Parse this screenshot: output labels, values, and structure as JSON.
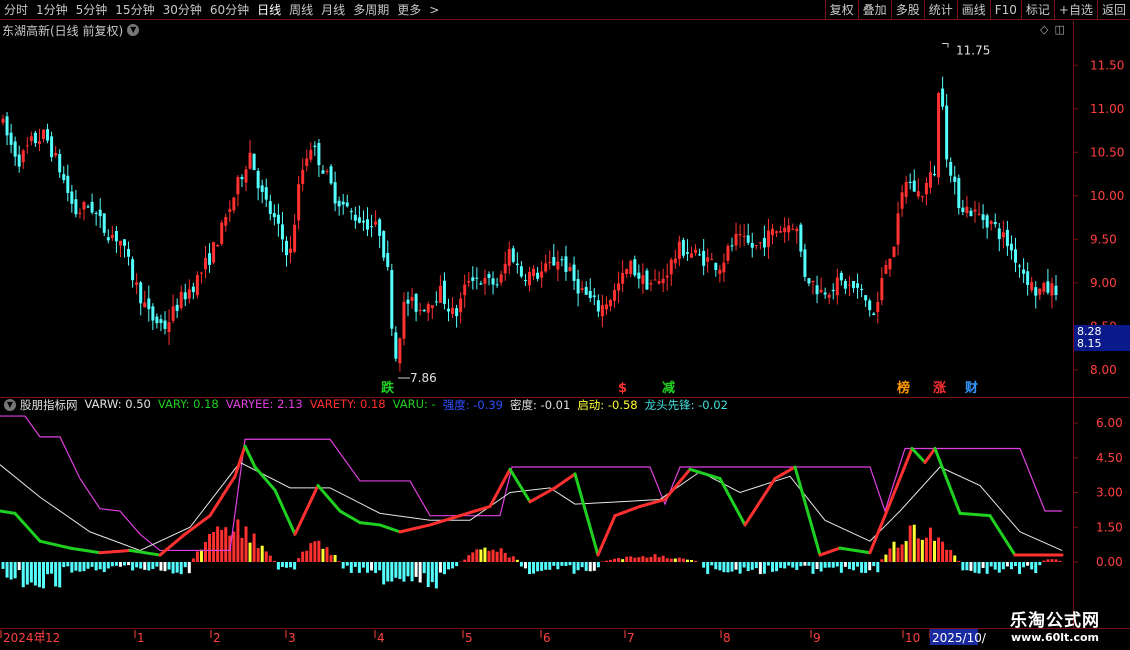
{
  "toolbar": {
    "periods": [
      "分时",
      "1分钟",
      "5分钟",
      "15分钟",
      "30分钟",
      "60分钟",
      "日线",
      "周线",
      "月线",
      "多周期",
      "更多"
    ],
    "active_period": "日线",
    "more_arrow": ">",
    "right_buttons": [
      "复权",
      "叠加",
      "多股",
      "统计",
      "画线",
      "F10",
      "标记",
      "+自选",
      "返回"
    ]
  },
  "title": {
    "stock": "东湖高新(日线 前复权)"
  },
  "price_axis": {
    "ticks": [
      "11.50",
      "11.00",
      "10.50",
      "10.00",
      "9.50",
      "9.00",
      "8.50",
      "8.00"
    ]
  },
  "price_box": {
    "line1": "8.28",
    "line2": "8.15"
  },
  "annotations": {
    "high": "11.75",
    "low": "7.86",
    "signals": [
      {
        "text": "跌",
        "color": "#20d020"
      },
      {
        "text": "$",
        "color": "#ff3030"
      },
      {
        "text": "减",
        "color": "#20d020"
      },
      {
        "text": "榜",
        "color": "#ff9900"
      },
      {
        "text": "涨",
        "color": "#ff3030"
      },
      {
        "text": "财",
        "color": "#3399ff"
      }
    ]
  },
  "indicator": {
    "name": "股朋指标网",
    "fields": [
      {
        "label": "VARW: 0.50",
        "color": "#e0e0e0"
      },
      {
        "label": "VARY: 0.18",
        "color": "#20d020"
      },
      {
        "label": "VARYEE: 2.13",
        "color": "#e040e0"
      },
      {
        "label": "VARETY: 0.18",
        "color": "#ff3030"
      },
      {
        "label": "VARU: -",
        "color": "#20d020"
      },
      {
        "label": "强度: -0.39",
        "color": "#3050ff"
      },
      {
        "label": "密度: -0.01",
        "color": "#e0e0e0"
      },
      {
        "label": "启动: -0.58",
        "color": "#ffff33"
      },
      {
        "label": "龙头先锋: -0.02",
        "color": "#40e0e0"
      }
    ],
    "axis_ticks": [
      "6.00",
      "4.50",
      "3.00",
      "1.50",
      "0.00"
    ]
  },
  "time_axis": {
    "labels": [
      "2024年",
      "12",
      "1",
      "2",
      "3",
      "4",
      "5",
      "6",
      "7",
      "8",
      "9",
      "10",
      "2025/10/"
    ]
  },
  "watermark": {
    "line1": "乐淘公式网",
    "line2": "www.60lt.com"
  },
  "colors": {
    "up": "#ff3030",
    "down": "#54ffff",
    "divider": "#7a1010",
    "magenta": "#e040e0",
    "green": "#20d020"
  }
}
